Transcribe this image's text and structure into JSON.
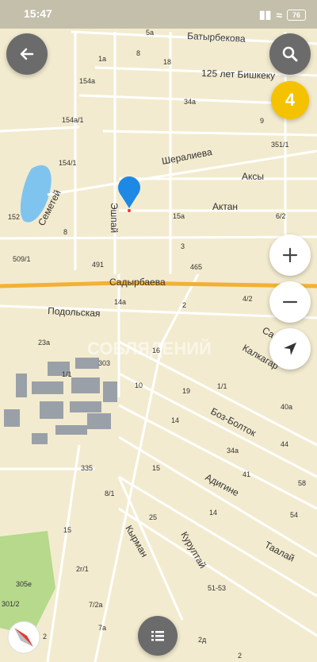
{
  "status_bar": {
    "time": "15:47",
    "battery": "76"
  },
  "badge_count": "4",
  "watermark": "СОБЛЯДЕНИЙ",
  "streets": {
    "batyrbekova": "Батырбекова",
    "bishkeku": "125 лет Бишкеку",
    "sheralieva": "Шералиева",
    "aksy": "Аксы",
    "aktan": "Актан",
    "semetei": "Семетей",
    "eshpai": "Эшпай",
    "sadyrbaeva": "Садырбаева",
    "podolskaya": "Подольская",
    "kalkagar": "Калкагар",
    "san": "Сан",
    "boz_boltok": "Боз-Болток",
    "adigine": "Адигине",
    "taalai": "Таалай",
    "kyrman": "Кырман",
    "kurultai": "Курултай"
  },
  "house_numbers": [
    "5a",
    "8",
    "1a",
    "18",
    "154a",
    "34a",
    "9",
    "154a/1",
    "351/1",
    "154/1",
    "152",
    "15a",
    "6/2",
    "8",
    "509/1",
    "491",
    "3",
    "465",
    "4/2",
    "14a",
    "2",
    "23a",
    "303",
    "1/1",
    "16",
    "10",
    "19",
    "1/1",
    "40a",
    "14",
    "44",
    "34a",
    "335",
    "15",
    "41",
    "58",
    "8/1",
    "25",
    "14",
    "54",
    "15",
    "2г/1",
    "7/2a",
    "51-53",
    "305e",
    "301/2",
    "2",
    "7a",
    "2д",
    "2"
  ],
  "colors": {
    "map_bg": "#f3ebcf",
    "arterial": "#f2b135",
    "pin": "#1e88e5",
    "badge": "#f5c200",
    "park": "#b6d98c",
    "water": "#7fc4ef"
  }
}
